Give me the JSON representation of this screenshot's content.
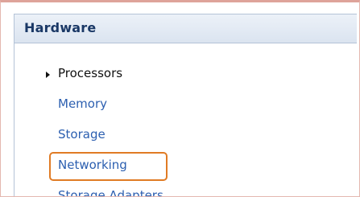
{
  "panel": {
    "title": "Hardware"
  },
  "nav": {
    "items": [
      {
        "label": "Processors",
        "current": true
      },
      {
        "label": "Memory"
      },
      {
        "label": "Storage"
      },
      {
        "label": "Networking",
        "highlighted": true
      },
      {
        "label": "Storage Adapters"
      }
    ]
  },
  "colors": {
    "title": "#1a3866",
    "link": "#2c5fb0",
    "highlight_outline": "#e07b24",
    "header_background": "#dbe4f0"
  },
  "icons": {
    "current_marker": "triangle-right-icon"
  }
}
